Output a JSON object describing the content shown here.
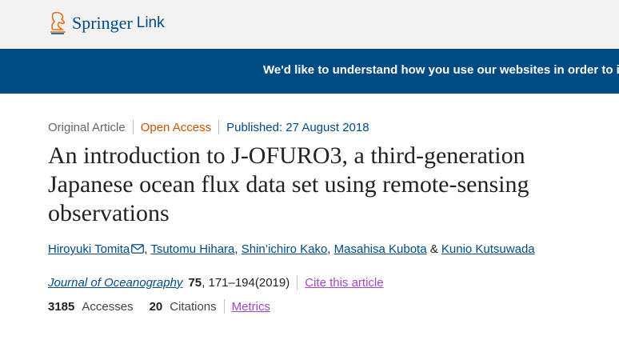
{
  "header": {
    "brand": "Springer",
    "brand_suffix": "Link"
  },
  "banner": {
    "text": "We'd like to understand how you use our websites in order to improve them. Register your interest."
  },
  "article": {
    "type": "Original Article",
    "access": "Open Access",
    "published": "Published: 27 August 2018",
    "title": "An introduction to J-OFURO3, a third-generation Japanese ocean flux data set using remote-sensing observations",
    "authors": [
      "Hiroyuki Tomita",
      "Tsutomu Hihara",
      "Shin’ichiro Kako",
      "Masahisa Kubota",
      "Kunio Kutsuwada"
    ],
    "author_sep": ", ",
    "author_last_sep": " & ",
    "journal": "Journal of Oceanography",
    "volume": "75",
    "pages": ", 171–194(2019)",
    "cite": "Cite this article",
    "accesses_count": "3185",
    "accesses_label": "Accesses",
    "citations_count": "20",
    "citations_label": "Citations",
    "metrics": "Metrics"
  },
  "colors": {
    "brand_blue": "#004b83",
    "open_access": "#c65301",
    "link_visited": "#a345c9"
  }
}
